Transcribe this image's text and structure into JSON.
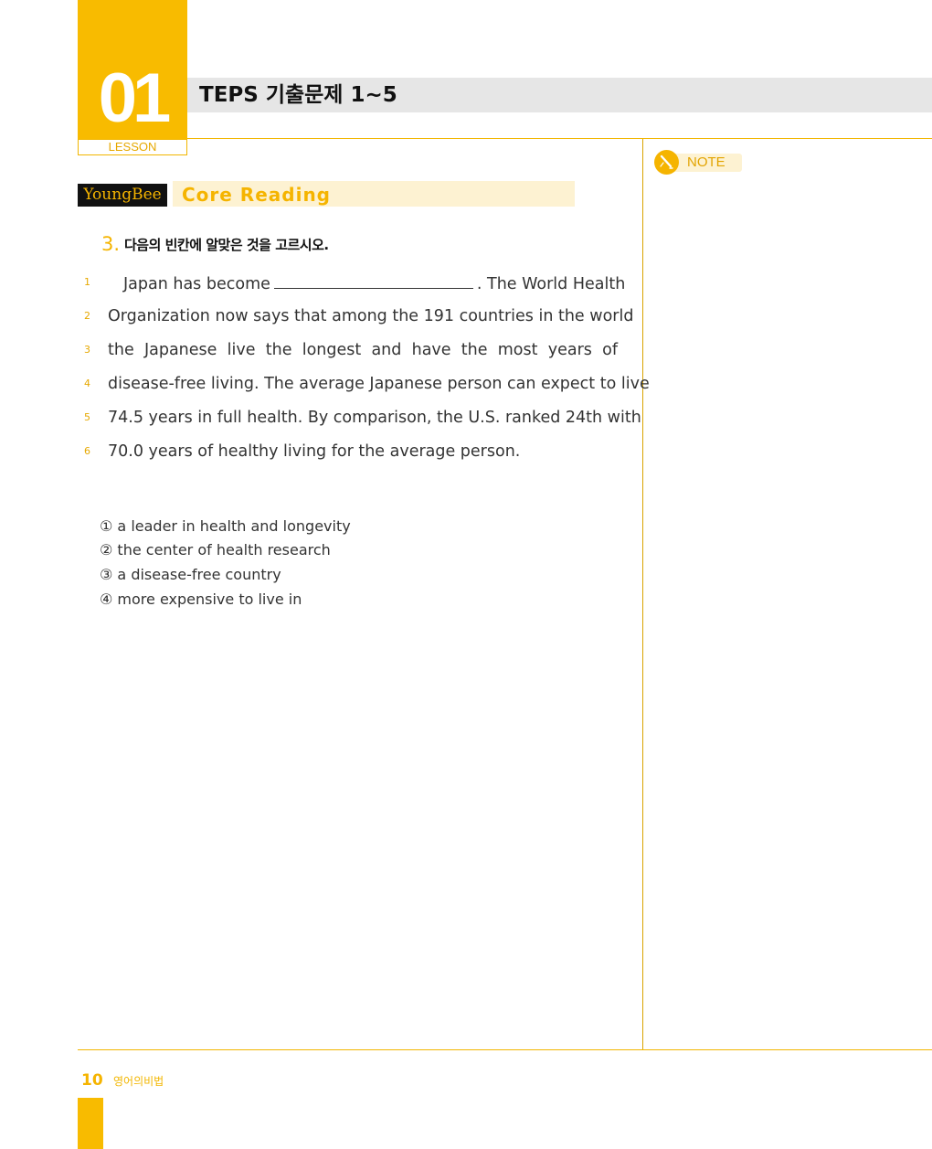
{
  "header": {
    "lesson_number": "01",
    "lesson_label": "LESSON",
    "title": "TEPS 기출문제 1~5"
  },
  "note": {
    "label": "NOTE",
    "icon": "pencil-icon"
  },
  "section": {
    "brand": "YoungBee",
    "title": "Core Reading"
  },
  "question": {
    "number": "3.",
    "instruction": "다음의 빈칸에 알맞은 것을 고르시오."
  },
  "passage": {
    "lines": [
      {
        "no": "1",
        "before": "Japan has become",
        "after": ". The World Health"
      },
      {
        "no": "2",
        "text": "Organization now says that among the 191 countries in the world"
      },
      {
        "no": "3",
        "text": "the Japanese live the longest and have the most years of"
      },
      {
        "no": "4",
        "text": "disease-free living. The average Japanese person can expect to live"
      },
      {
        "no": "5",
        "text": "74.5 years in full health. By comparison, the U.S. ranked 24th with"
      },
      {
        "no": "6",
        "text": "70.0 years of healthy living for the average person."
      }
    ]
  },
  "options": [
    "① a leader in health and longevity",
    "② the center of health research",
    "③ a disease-free country",
    "④ more expensive to live in"
  ],
  "footer": {
    "page_number": "10",
    "book_title": "영어의비법"
  },
  "colors": {
    "accent": "#f8bb00",
    "accent_light": "#fdf2d2",
    "title_bar": "#e6e6e6"
  }
}
